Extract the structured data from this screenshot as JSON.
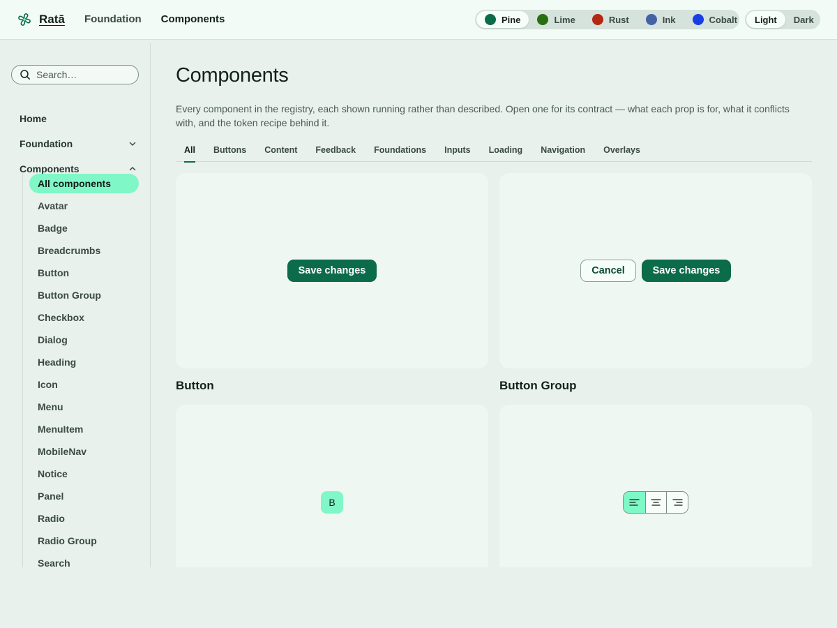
{
  "header": {
    "brand": "Ratā",
    "nav": [
      "Foundation",
      "Components"
    ],
    "active_nav": "Components",
    "themes": [
      {
        "label": "Pine",
        "color": "#0b6b4a"
      },
      {
        "label": "Lime",
        "color": "#2a6e12"
      },
      {
        "label": "Rust",
        "color": "#b42712"
      },
      {
        "label": "Ink",
        "color": "#4363a4"
      },
      {
        "label": "Cobalt",
        "color": "#1a3ee6"
      }
    ],
    "active_theme": "Pine",
    "modes": [
      "Light",
      "Dark"
    ],
    "active_mode": "Light"
  },
  "sidebar": {
    "search_placeholder": "Search…",
    "top_items": [
      {
        "label": "Home",
        "expandable": false
      },
      {
        "label": "Foundation",
        "expandable": true,
        "expanded": false
      },
      {
        "label": "Components",
        "expandable": true,
        "expanded": true
      }
    ],
    "component_items": [
      "All components",
      "Avatar",
      "Badge",
      "Breadcrumbs",
      "Button",
      "Button Group",
      "Checkbox",
      "Dialog",
      "Heading",
      "Icon",
      "Menu",
      "MenuItem",
      "MobileNav",
      "Notice",
      "Panel",
      "Radio",
      "Radio Group",
      "Search"
    ],
    "active_item": "All components"
  },
  "main": {
    "title": "Components",
    "intro": "Every component in the registry, each shown running rather than described. Open one for its contract — what each prop is for, what it conflicts with, and the token recipe behind it.",
    "tabs": [
      "All",
      "Buttons",
      "Content",
      "Feedback",
      "Foundations",
      "Inputs",
      "Loading",
      "Navigation",
      "Overlays"
    ],
    "active_tab": "All",
    "cards": {
      "button": {
        "name": "Button",
        "demo_label": "Save changes"
      },
      "button_group": {
        "name": "Button Group",
        "cancel_label": "Cancel",
        "save_label": "Save changes"
      },
      "avatar": {
        "initial": "B"
      },
      "align_group": {
        "options": [
          "align-left",
          "align-center",
          "align-right"
        ],
        "selected": "align-left"
      }
    }
  },
  "colors": {
    "accent": "#0b6b4a",
    "accent_mint": "#7ff7c7",
    "page_bg": "#e8f1ec",
    "header_bg": "#f2fbf6"
  }
}
